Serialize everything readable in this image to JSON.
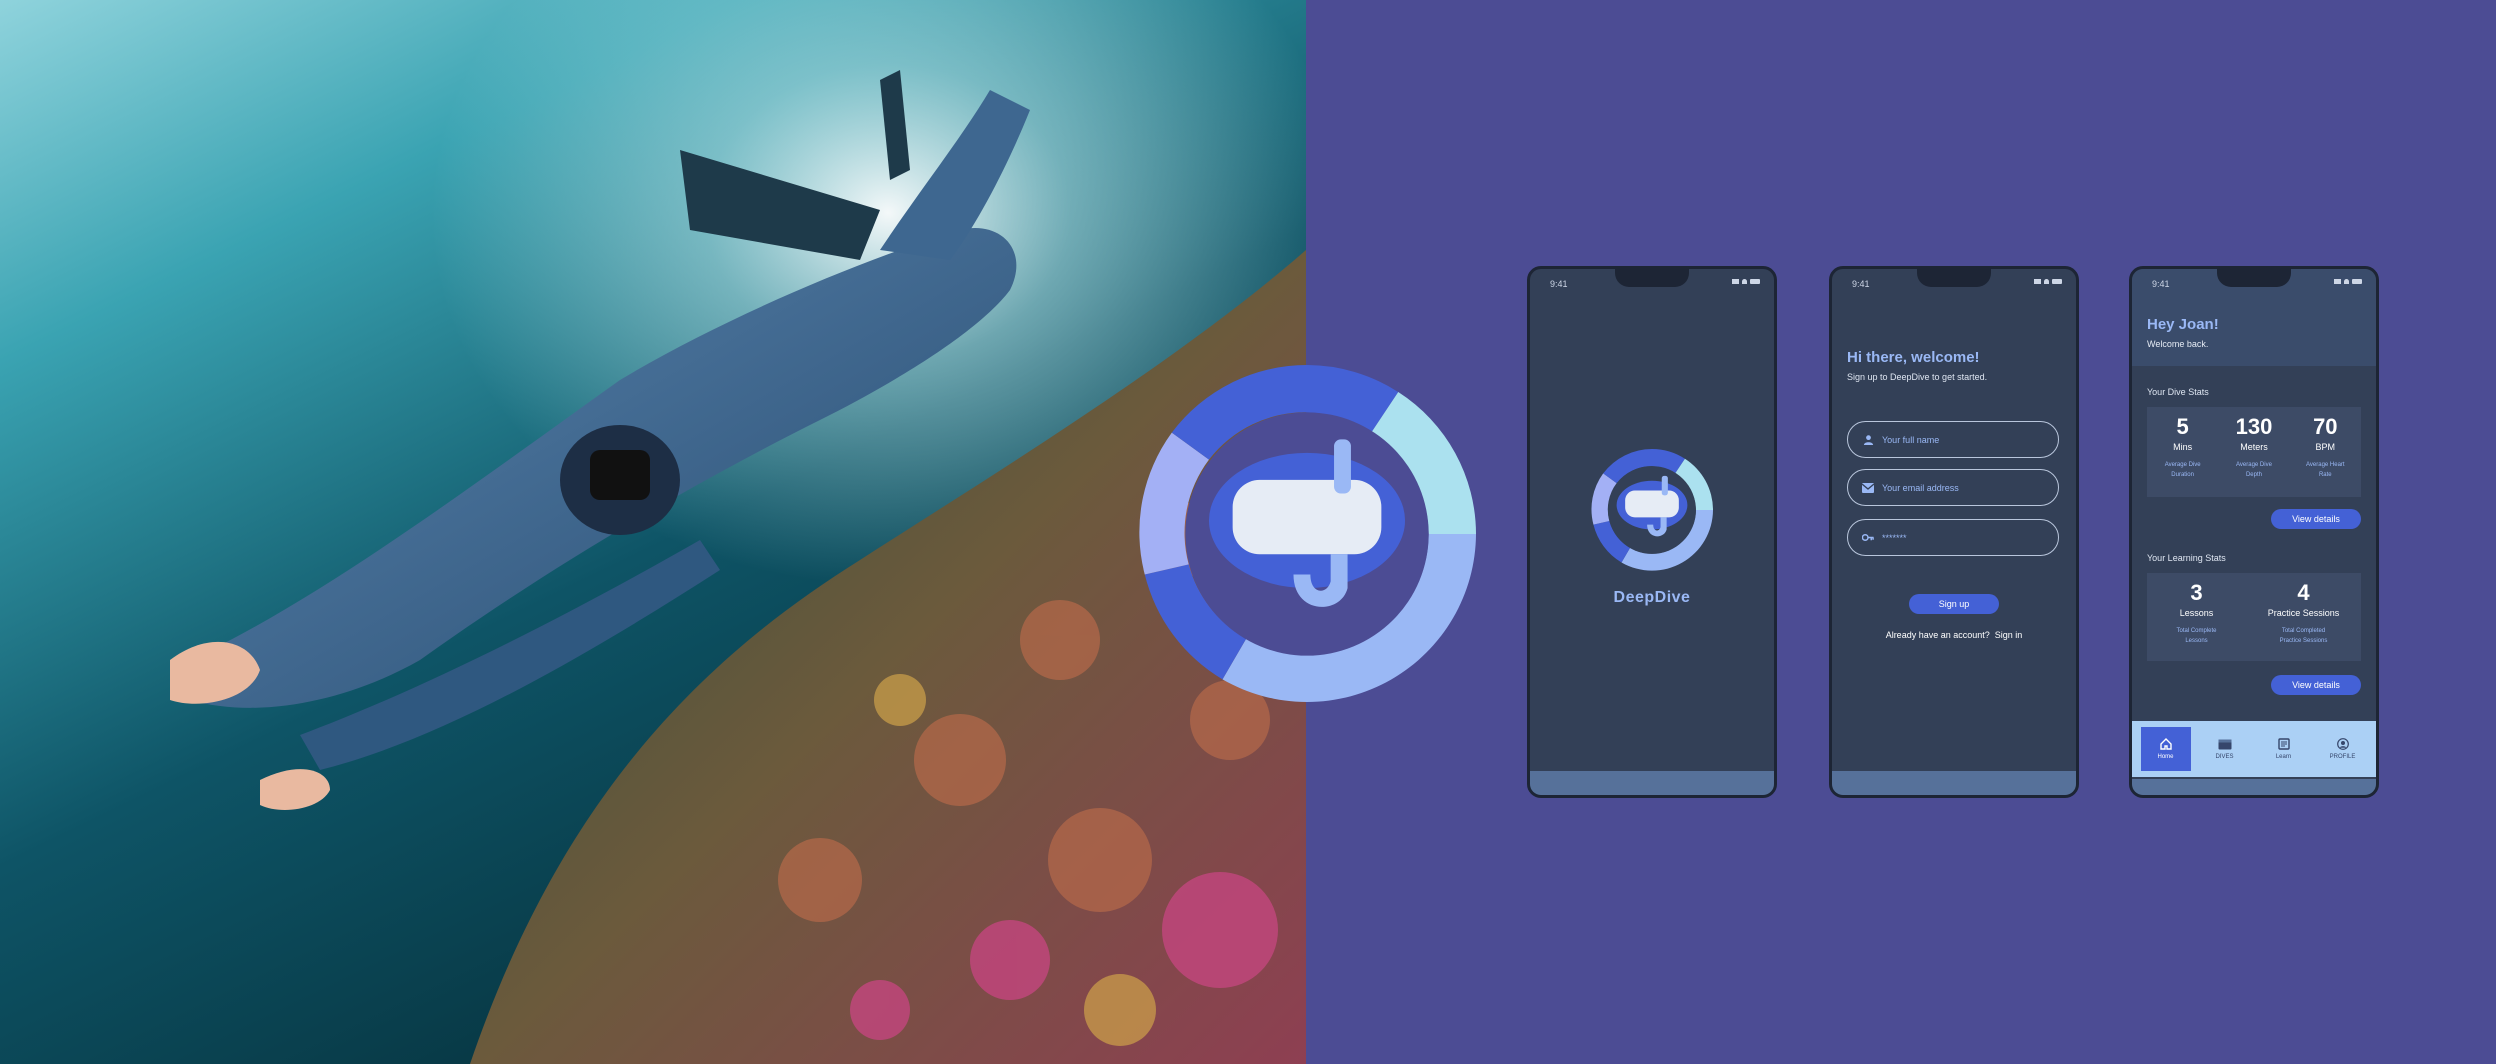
{
  "colors": {
    "background": "#4c4c94",
    "phone_bg": "#334057",
    "accent": "#4461d6",
    "accent_light": "#9ab8f5",
    "logo_ring": [
      "#4461d6",
      "#abe1ef",
      "#9ab8f5",
      "#4461d6",
      "#a3b0f5"
    ]
  },
  "hero_image": {
    "description_icon": "freediver-photo"
  },
  "status_bar": {
    "time": "9:41"
  },
  "splash": {
    "app_name": "DeepDive"
  },
  "signup": {
    "title": "Hi there, welcome!",
    "subtitle": "Sign up to DeepDive to get started.",
    "name_placeholder": "Your full name",
    "email_placeholder": "Your email address",
    "password_placeholder": "*******",
    "signup_button": "Sign up",
    "signin_prompt": "Already have an account?",
    "signin_link": "Sign in"
  },
  "home": {
    "greeting": "Hey Joan!",
    "welcome": "Welcome back.",
    "dive_stats_title": "Your Dive Stats",
    "dive_stats": [
      {
        "value": "5",
        "unit": "Mins",
        "caption_1": "Average Dive",
        "caption_2": "Duration"
      },
      {
        "value": "130",
        "unit": "Meters",
        "caption_1": "Average Dive",
        "caption_2": "Depth"
      },
      {
        "value": "70",
        "unit": "BPM",
        "caption_1": "Average Heart",
        "caption_2": "Rate"
      }
    ],
    "view_details": "View details",
    "learning_stats_title": "Your Learning Stats",
    "learning_stats": [
      {
        "value": "3",
        "unit": "Lessons",
        "caption_1": "Total Complete",
        "caption_2": "Lessons"
      },
      {
        "value": "4",
        "unit": "Practice Sessions",
        "caption_1": "Total Completed",
        "caption_2": "Practice Sessions"
      }
    ],
    "nav": [
      {
        "label": "Home",
        "icon": "home-icon"
      },
      {
        "label": "DIVES",
        "icon": "calendar-icon"
      },
      {
        "label": "Learn",
        "icon": "book-icon"
      },
      {
        "label": "PROFILE",
        "icon": "profile-icon"
      }
    ]
  }
}
